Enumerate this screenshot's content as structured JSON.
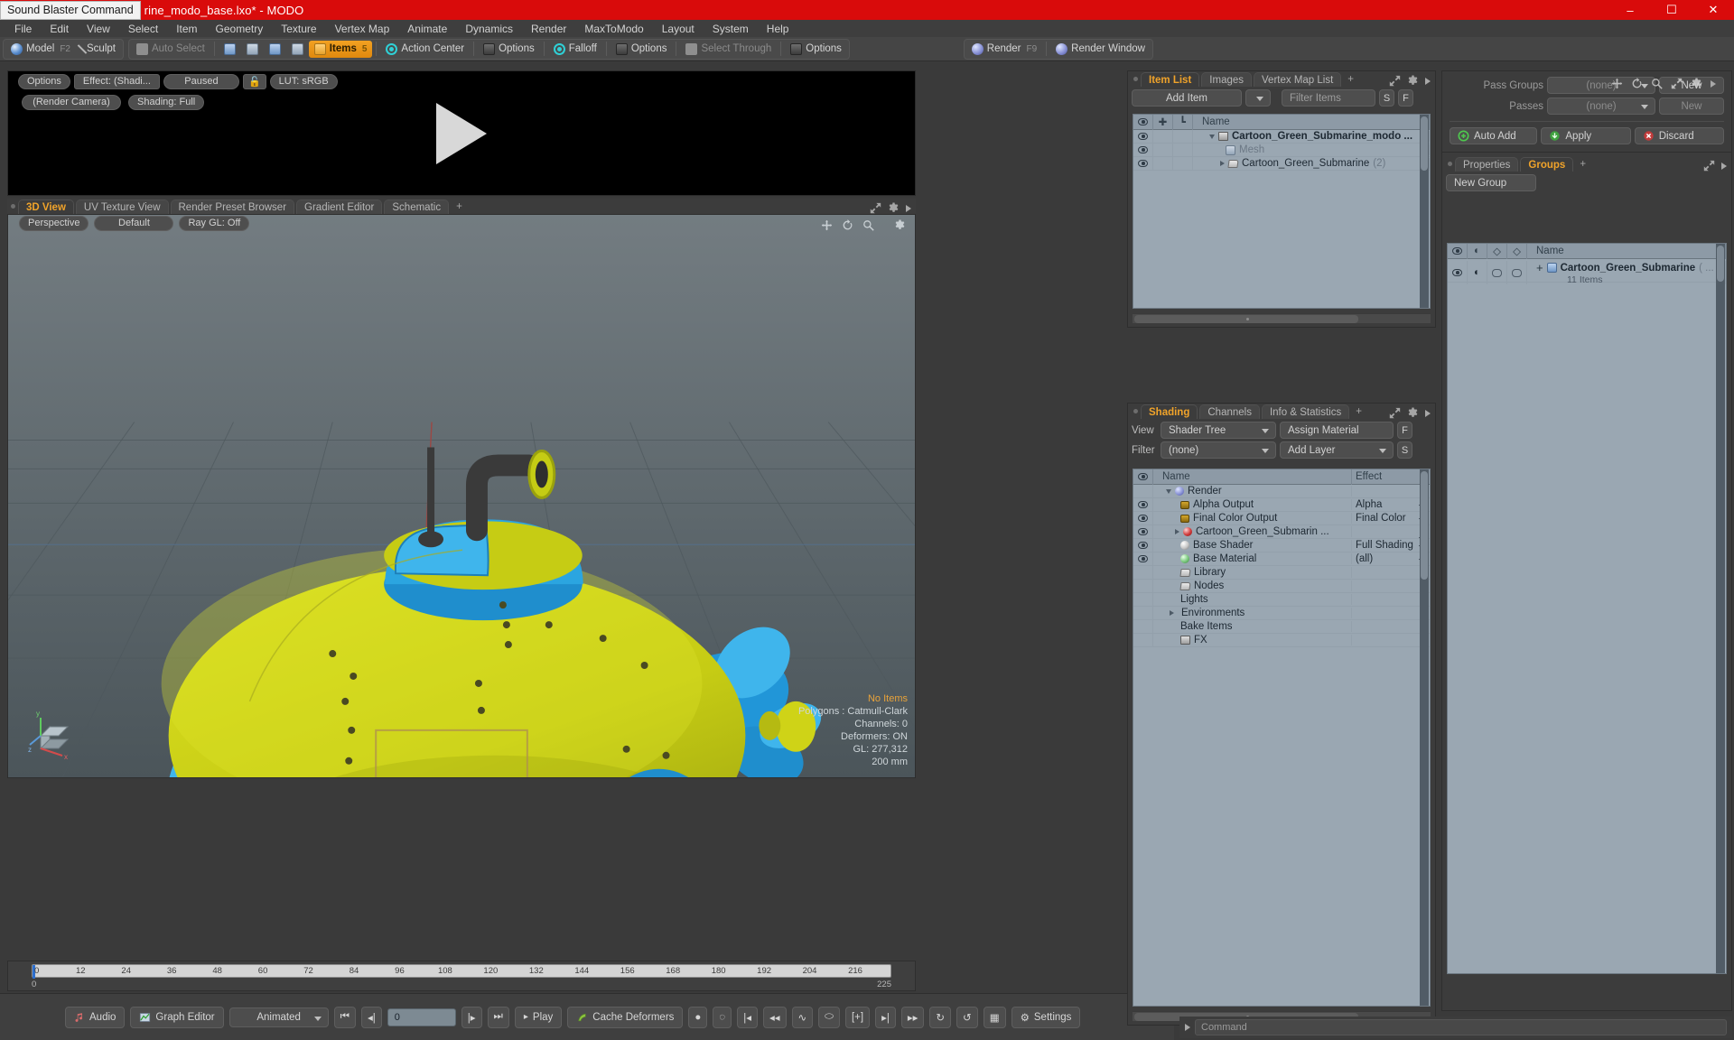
{
  "window": {
    "overlay_app": "Sound Blaster Command",
    "title": "rine_modo_base.lxo* - MODO",
    "buttons": [
      "minimize",
      "maximize",
      "close"
    ]
  },
  "menubar": [
    "File",
    "Edit",
    "View",
    "Select",
    "Item",
    "Geometry",
    "Texture",
    "Vertex Map",
    "Animate",
    "Dynamics",
    "Render",
    "MaxToModo",
    "Layout",
    "System",
    "Help"
  ],
  "modebar": {
    "model": "Model",
    "model_key": "F2",
    "sculpt": "Sculpt",
    "auto_select": "Auto Select",
    "items": "Items",
    "items_key": "5",
    "action_center": "Action Center",
    "options1": "Options",
    "falloff": "Falloff",
    "options2": "Options",
    "select_through": "Select Through",
    "options3": "Options",
    "render": "Render",
    "render_key": "F9",
    "render_window": "Render Window"
  },
  "render_preview": {
    "options": "Options",
    "effect": "Effect: (Shadi...",
    "paused": "Paused",
    "lut": "LUT: sRGB",
    "camera": "(Render Camera)",
    "shading": "Shading: Full",
    "icons": [
      "move-icon",
      "refresh-icon",
      "zoom-icon",
      "fit-icon",
      "gear-icon",
      "arrow-icon"
    ]
  },
  "viewport": {
    "tabs": [
      {
        "label": "3D View",
        "active": true
      },
      {
        "label": "UV Texture View",
        "active": false
      },
      {
        "label": "Render Preset Browser",
        "active": false
      },
      {
        "label": "Gradient Editor",
        "active": false
      },
      {
        "label": "Schematic",
        "active": false
      },
      {
        "label": "+",
        "active": false
      }
    ],
    "controls": [
      "Perspective",
      "Default",
      "Ray GL: Off"
    ],
    "stats": {
      "no_items": "No Items",
      "polygons": "Polygons : Catmull-Clark",
      "channels": "Channels: 0",
      "deformers": "Deformers: ON",
      "gl": "GL: 277,312",
      "scale": "200 mm"
    },
    "axis": {
      "x": "x",
      "y": "y",
      "z": "z"
    }
  },
  "timeline": {
    "ticks": [
      "0",
      "12",
      "24",
      "36",
      "48",
      "60",
      "72",
      "84",
      "96",
      "108",
      "120",
      "132",
      "144",
      "156",
      "168",
      "180",
      "192",
      "204",
      "216"
    ],
    "end_left": "0",
    "end_right": "225",
    "range_right": "225"
  },
  "bottombar": {
    "audio": "Audio",
    "graph_editor": "Graph Editor",
    "mode": "Animated",
    "frame_value": "0",
    "play": "Play",
    "cache_deformers": "Cache Deformers",
    "settings": "Settings"
  },
  "item_list": {
    "tabs": [
      {
        "label": "Item List",
        "active": true
      },
      {
        "label": "Images",
        "active": false
      },
      {
        "label": "Vertex Map List",
        "active": false
      },
      {
        "label": "+",
        "active": false
      }
    ],
    "add_item": "Add Item",
    "filter_placeholder": "Filter Items",
    "btn_s": "S",
    "btn_f": "F",
    "columns": [
      "eye",
      "move",
      "axis",
      "Name"
    ],
    "rows": [
      {
        "name": "Cartoon_Green_Submarine_modo ...",
        "icon": "clapboard-icon",
        "indent": 1,
        "expander": "down",
        "bold": true,
        "suffix": ""
      },
      {
        "name": "Mesh",
        "icon": "mesh-icon",
        "indent": 2,
        "expander": "none",
        "bold": false,
        "dim": true,
        "suffix": ""
      },
      {
        "name": "Cartoon_Green_Submarine",
        "icon": "folder-icon",
        "indent": 2,
        "expander": "right",
        "bold": false,
        "suffix": "(2)"
      }
    ]
  },
  "shading": {
    "tabs": [
      {
        "label": "Shading",
        "active": true
      },
      {
        "label": "Channels",
        "active": false
      },
      {
        "label": "Info & Statistics",
        "active": false
      },
      {
        "label": "+",
        "active": false
      }
    ],
    "view_label": "View",
    "view_value": "Shader Tree",
    "assign_material": "Assign Material",
    "filter_label": "Filter",
    "filter_value": "(none)",
    "add_layer": "Add Layer",
    "btn_f": "F",
    "btn_s": "S",
    "columns": [
      "eye",
      "Name",
      "Effect"
    ],
    "rows": [
      {
        "name": "Render",
        "effect": "",
        "icon": "blue-sphere-icon",
        "indent": 1,
        "expander": "down",
        "eye": false,
        "caret": false
      },
      {
        "name": "Alpha Output",
        "effect": "Alpha",
        "icon": "image-icon",
        "indent": 2,
        "expander": "none",
        "eye": true,
        "caret": true
      },
      {
        "name": "Final Color Output",
        "effect": "Final Color",
        "icon": "image-icon",
        "indent": 2,
        "expander": "none",
        "eye": true,
        "caret": true
      },
      {
        "name": "Cartoon_Green_Submarin ...",
        "effect": "",
        "icon": "red-sphere-icon",
        "indent": 2,
        "expander": "right",
        "eye": true,
        "caret": true
      },
      {
        "name": "Base Shader",
        "effect": "Full Shading",
        "icon": "white-sphere-icon",
        "indent": 2,
        "expander": "none",
        "eye": true,
        "caret": true
      },
      {
        "name": "Base Material",
        "effect": "(all)",
        "icon": "green-sphere-icon",
        "indent": 2,
        "expander": "none",
        "eye": true,
        "caret": true
      },
      {
        "name": "Library",
        "effect": "",
        "icon": "folder-icon",
        "indent": 2,
        "expander": "none",
        "eye": false,
        "caret": false
      },
      {
        "name": "Nodes",
        "effect": "",
        "icon": "folder-icon",
        "indent": 2,
        "expander": "none",
        "eye": false,
        "caret": false
      },
      {
        "name": "Lights",
        "effect": "",
        "icon": "none",
        "indent": 2,
        "expander": "none",
        "eye": false,
        "caret": false
      },
      {
        "name": "Environments",
        "effect": "",
        "icon": "none",
        "indent": 2,
        "expander": "right",
        "eye": false,
        "caret": false
      },
      {
        "name": "Bake Items",
        "effect": "",
        "icon": "none",
        "indent": 2,
        "expander": "none",
        "eye": false,
        "caret": false
      },
      {
        "name": "FX",
        "effect": "",
        "icon": "clapboard-icon",
        "indent": 2,
        "expander": "none",
        "eye": false,
        "caret": false
      }
    ]
  },
  "passes": {
    "pass_groups_label": "Pass Groups",
    "pass_groups_value": "(none)",
    "pass_groups_new": "New",
    "passes_label": "Passes",
    "passes_value": "(none)",
    "passes_new": "New",
    "auto_add": "Auto Add",
    "apply": "Apply",
    "discard": "Discard"
  },
  "groups": {
    "tabs": [
      {
        "label": "Properties",
        "active": false
      },
      {
        "label": "Groups",
        "active": true
      },
      {
        "label": "+",
        "active": false
      }
    ],
    "new_group": "New Group",
    "columns": [
      "eye",
      "shade",
      "box1",
      "box2",
      "Name"
    ],
    "rows": [
      {
        "name": "Cartoon_Green_Submarine",
        "suffix": "( ...",
        "sub": "11 Items"
      }
    ]
  },
  "command": {
    "placeholder": "Command"
  },
  "colors": {
    "accent": "#f0a32a",
    "title_bar": "#d90b0b",
    "panel_bg": "#3c3c3c",
    "list_bg": "#9aa7b2",
    "viewport": "#5c666b"
  }
}
